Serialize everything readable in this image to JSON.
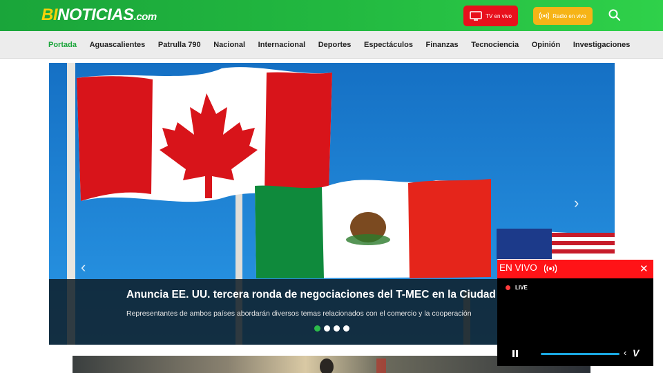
{
  "header": {
    "logo_bi": "BI",
    "logo_main": "NOTICIAS",
    "logo_com": ".com",
    "tv_label": "TV en vivo",
    "radio_label": "Radio en vivo"
  },
  "nav": {
    "items": [
      {
        "label": "Portada",
        "active": true
      },
      {
        "label": "Aguascalientes"
      },
      {
        "label": "Patrulla 790"
      },
      {
        "label": "Nacional"
      },
      {
        "label": "Internacional"
      },
      {
        "label": "Deportes"
      },
      {
        "label": "Espectáculos"
      },
      {
        "label": "Finanzas"
      },
      {
        "label": "Tecnociencia"
      },
      {
        "label": "Opinión"
      },
      {
        "label": "Investigaciones"
      }
    ]
  },
  "hero": {
    "headline": "Anuncia EE. UU. tercera ronda de negociaciones del T-MEC en la Ciudad de",
    "summary": "Representantes de ambos países abordarán diversos temas relacionados con el comercio y la cooperación",
    "slides": 4,
    "active_slide": 0
  },
  "player": {
    "title": "EN VIVO",
    "live_label": "LIVE",
    "vimeo_mark": "V"
  },
  "colors": {
    "brand_green": "#1aa53a",
    "tv_red": "#e8101c",
    "radio_yellow": "#f6b417",
    "live_red": "#ff1317"
  }
}
